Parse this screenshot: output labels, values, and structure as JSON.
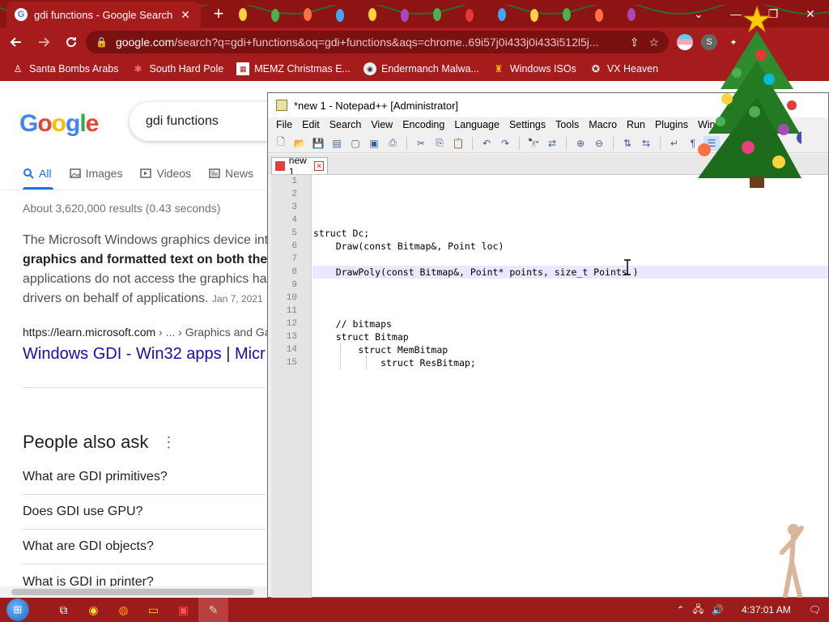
{
  "browser": {
    "tab_title": "gdi functions - Google Search",
    "tab_close_glyph": "✕",
    "new_tab_glyph": "+",
    "window_controls": [
      "⌄",
      "—",
      "❐",
      "✕"
    ],
    "url": "google.com/search?q=gdi+functions&oq=gdi+functions&aqs=chrome..69i57j0i433j0i433i512l5j...",
    "url_host": "google.com",
    "url_rest": "/search?q=gdi+functions&oq=gdi+functions&aqs=chrome..69i57j0i433j0i433i512l5j...",
    "bookmarks": [
      {
        "label": "Santa Bombs Arabs",
        "icon": "santa-icon"
      },
      {
        "label": "South Hard Pole",
        "icon": "snowflake-icon"
      },
      {
        "label": "MEMZ Christmas E...",
        "icon": "memz-icon"
      },
      {
        "label": "Endermanch Malwa...",
        "icon": "endermanch-icon"
      },
      {
        "label": "Windows ISOs",
        "icon": "windows-isos-icon"
      },
      {
        "label": "VX Heaven",
        "icon": "vx-heaven-icon"
      }
    ]
  },
  "google": {
    "logo": [
      "G",
      "o",
      "o",
      "g",
      "l",
      "e"
    ],
    "query": "gdi functions",
    "tabs": [
      {
        "label": "All",
        "icon": "search-icon",
        "active": true
      },
      {
        "label": "Images",
        "icon": "image-icon",
        "active": false
      },
      {
        "label": "Videos",
        "icon": "video-icon",
        "active": false
      },
      {
        "label": "News",
        "icon": "news-icon",
        "active": false
      }
    ],
    "stats": "About 3,620,000 results (0.43 seconds)",
    "snippet_lines": [
      "The Microsoft Windows graphics device int",
      "graphics and formatted text on both the",
      "applications do not access the graphics ha",
      "drivers on behalf of applications."
    ],
    "snippet_date": "Jan 7, 2021",
    "cite_host": "https://learn.microsoft.com",
    "cite_path": " › ... › Graphics and Ga",
    "result_title": "Windows GDI - Win32 apps | Micr",
    "paa_title": "People also ask",
    "paa_items": [
      "What are GDI primitives?",
      "Does GDI use GPU?",
      "What are GDI objects?",
      "What is GDI in printer?"
    ]
  },
  "notepadpp": {
    "title": "*new 1 - Notepad++ [Administrator]",
    "menu": [
      "File",
      "Edit",
      "Search",
      "View",
      "Encoding",
      "Language",
      "Settings",
      "Tools",
      "Macro",
      "Run",
      "Plugins",
      "Win"
    ],
    "tab_label": "new 1",
    "lines": [
      {
        "n": "1",
        "text": ""
      },
      {
        "n": "2",
        "text": ""
      },
      {
        "n": "3",
        "text": ""
      },
      {
        "n": "4",
        "text": ""
      },
      {
        "n": "5",
        "text": "struct Dc;"
      },
      {
        "n": "6",
        "text": "    Draw(const Bitmap&, Point loc)"
      },
      {
        "n": "7",
        "text": ""
      },
      {
        "n": "8",
        "text": "    DrawPoly(const Bitmap&, Point* points, size_t Points )"
      },
      {
        "n": "9",
        "text": ""
      },
      {
        "n": "10",
        "text": ""
      },
      {
        "n": "11",
        "text": ""
      },
      {
        "n": "12",
        "text": "    // bitmaps"
      },
      {
        "n": "13",
        "text": "    struct Bitmap"
      },
      {
        "n": "14",
        "text": "        struct MemBitmap"
      },
      {
        "n": "15",
        "text": "            struct ResBitmap;"
      }
    ]
  },
  "taskbar": {
    "start_glyph": "⊞",
    "clock": "4:37:01 AM",
    "apps": [
      {
        "name": "task-view-icon",
        "glyph": "⧉"
      },
      {
        "name": "chrome-icon",
        "glyph": "◉"
      },
      {
        "name": "firefox-icon",
        "glyph": "◍"
      },
      {
        "name": "file-explorer-icon",
        "glyph": "▭"
      },
      {
        "name": "ctf-app-icon",
        "glyph": "▣"
      },
      {
        "name": "notepadpp-icon",
        "glyph": "✎"
      }
    ]
  },
  "colors": {
    "chrome_frame": "#8e1414",
    "chrome_toolbar": "#a61c1c",
    "taskbar": "#9c1b1b",
    "google_link": "#1a0dab",
    "google_blue": "#1a73e8"
  }
}
